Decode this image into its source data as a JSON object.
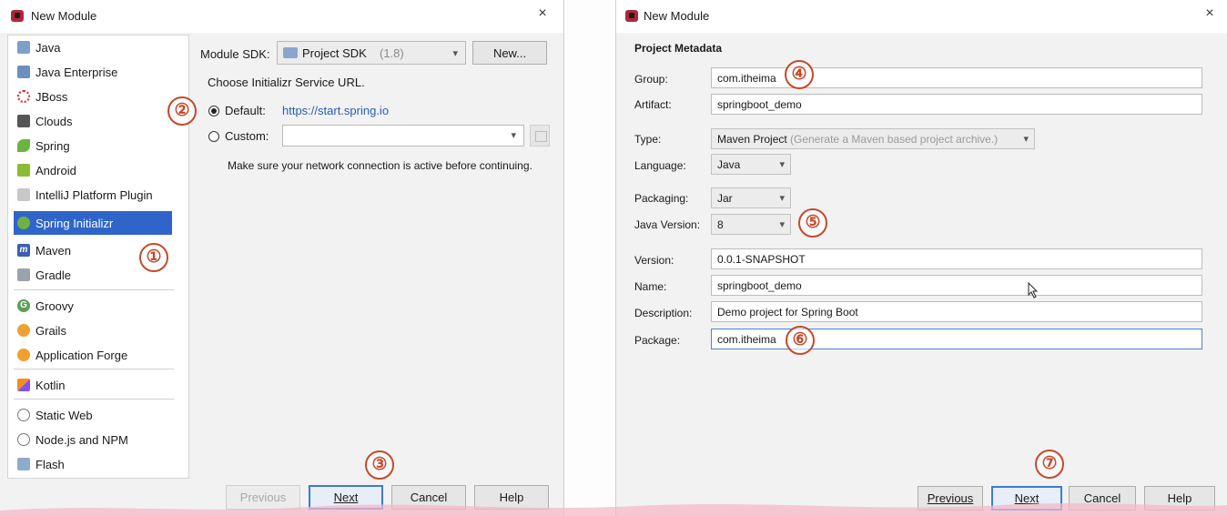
{
  "left_dialog": {
    "title": "New Module",
    "close": "×",
    "sidebar_items": [
      {
        "label": "Java",
        "icon": "java-folder-icon"
      },
      {
        "label": "Java Enterprise",
        "icon": "java-enterprise-icon"
      },
      {
        "label": "JBoss",
        "icon": "jboss-icon"
      },
      {
        "label": "Clouds",
        "icon": "clouds-icon"
      },
      {
        "label": "Spring",
        "icon": "spring-leaf-icon"
      },
      {
        "label": "Android",
        "icon": "android-icon"
      },
      {
        "label": "IntelliJ Platform Plugin",
        "icon": "intellij-plugin-icon"
      },
      {
        "label": "Spring Initializr",
        "icon": "spring-initializr-icon",
        "selected": true
      },
      {
        "label": "Maven",
        "icon": "maven-icon"
      },
      {
        "label": "Gradle",
        "icon": "gradle-icon"
      },
      {
        "label": "Groovy",
        "icon": "groovy-icon"
      },
      {
        "label": "Grails",
        "icon": "grails-icon"
      },
      {
        "label": "Application Forge",
        "icon": "application-forge-icon"
      },
      {
        "label": "Kotlin",
        "icon": "kotlin-icon"
      },
      {
        "label": "Static Web",
        "icon": "static-web-icon"
      },
      {
        "label": "Node.js and NPM",
        "icon": "nodejs-icon"
      },
      {
        "label": "Flash",
        "icon": "flash-icon"
      }
    ],
    "module_sdk_label": "Module SDK:",
    "module_sdk_value": "Project SDK",
    "module_sdk_version": "(1.8)",
    "new_button": "New...",
    "choose_url_label": "Choose Initializr Service URL.",
    "default_label": "Default:",
    "default_url": "https://start.spring.io",
    "custom_label": "Custom:",
    "network_note": "Make sure your network connection is active before continuing.",
    "buttons": {
      "previous": "Previous",
      "next": "Next",
      "cancel": "Cancel",
      "help": "Help"
    },
    "badges": [
      "①",
      "②",
      "③"
    ]
  },
  "right_dialog": {
    "title": "New Module",
    "close": "×",
    "section_title": "Project Metadata",
    "fields": {
      "group": {
        "label": "Group:",
        "value": "com.itheima"
      },
      "artifact": {
        "label": "Artifact:",
        "value": "springboot_demo"
      },
      "type": {
        "label": "Type:",
        "value": "Maven Project",
        "hint": "(Generate a Maven based project archive.)"
      },
      "language": {
        "label": "Language:",
        "value": "Java"
      },
      "packaging": {
        "label": "Packaging:",
        "value": "Jar"
      },
      "java_version": {
        "label": "Java Version:",
        "value": "8"
      },
      "version": {
        "label": "Version:",
        "value": "0.0.1-SNAPSHOT"
      },
      "name": {
        "label": "Name:",
        "value": "springboot_demo"
      },
      "description": {
        "label": "Description:",
        "value": "Demo project for Spring Boot"
      },
      "package": {
        "label": "Package:",
        "value": "com.itheima"
      }
    },
    "buttons": {
      "previous": "Previous",
      "next": "Next",
      "cancel": "Cancel",
      "help": "Help"
    },
    "badges": [
      "④",
      "⑤",
      "⑥",
      "⑦"
    ]
  },
  "colors": {
    "selection": "#2f65ca",
    "link": "#2a5db0",
    "annotation": "#c44a2a"
  }
}
